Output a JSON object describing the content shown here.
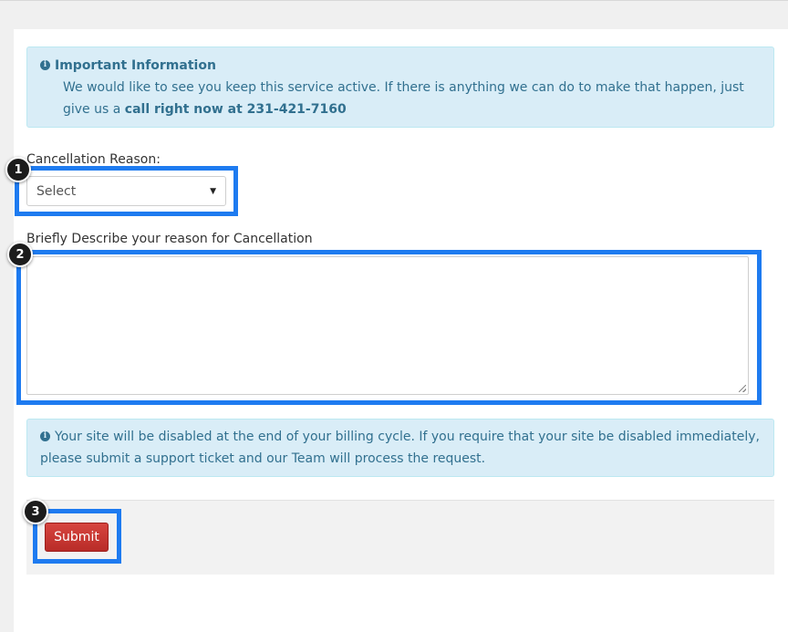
{
  "info_alert": {
    "title": "Important Information",
    "message": "We would like to see you keep this service active. If there is anything we can do to make that happen, just give us a",
    "emphasis": "call right now at 231-421-7160",
    "icon": "info-circle-icon"
  },
  "form": {
    "reason_label": "Cancellation Reason:",
    "reason_select_value": "Select",
    "describe_label": "Briefly Describe your reason for Cancellation",
    "describe_value": ""
  },
  "notice_alert": {
    "message": "Your site will be disabled at the end of your billing cycle. If you require that your site be disabled immediately, please submit a support ticket and our Team will process the request.",
    "icon": "info-circle-icon"
  },
  "actions": {
    "submit_label": "Submit"
  },
  "callouts": [
    "1",
    "2",
    "3"
  ],
  "colors": {
    "alert_bg": "#d9edf7",
    "alert_text": "#31708f",
    "submit_bg": "#c9302c",
    "highlight": "#1e7bf0",
    "badge": "#1c1c1c"
  }
}
